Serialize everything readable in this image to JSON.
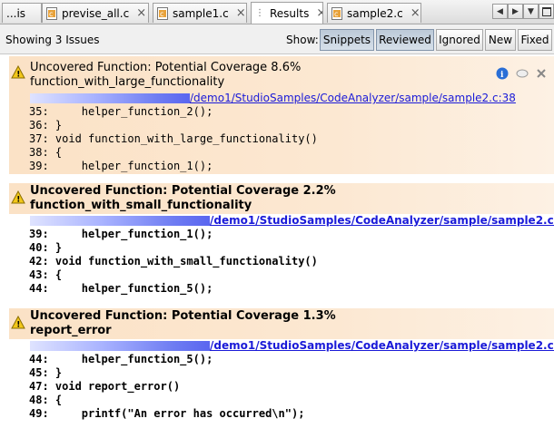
{
  "tabs": [
    {
      "label": "...is",
      "icon": "c-file-icon"
    },
    {
      "label": "previse_all.c",
      "icon": "c-file-icon"
    },
    {
      "label": "sample1.c",
      "icon": "c-file-icon"
    },
    {
      "label": "Results",
      "icon": "results-icon"
    },
    {
      "label": "sample2.c",
      "icon": "c-file-icon"
    }
  ],
  "close_glyph": "×",
  "toolbar": {
    "status": "Showing 3 Issues",
    "show_label": "Show:",
    "filters": [
      {
        "label": "Snippets",
        "pressed": true
      },
      {
        "label": "Reviewed",
        "pressed": true
      },
      {
        "label": "Ignored",
        "pressed": false
      },
      {
        "label": "New",
        "pressed": false
      },
      {
        "label": "Fixed",
        "pressed": false
      }
    ]
  },
  "issues": [
    {
      "title": "Uncovered Function: Potential Coverage 8.6%",
      "function": "function_with_large_functionality",
      "path": "/demo1/StudioSamples/CodeAnalyzer/sample/sample2.c:38",
      "lines": [
        "35:     helper_function_2();",
        "36: }",
        "37: void function_with_large_functionality()",
        "38: {",
        "39:     helper_function_1();"
      ]
    },
    {
      "title": "Uncovered Function: Potential Coverage 2.2%",
      "function": "function_with_small_functionality",
      "path": "/demo1/StudioSamples/CodeAnalyzer/sample/sample2.c:43",
      "lines": [
        "39:     helper_function_1();",
        "40: }",
        "42: void function_with_small_functionality()",
        "43: {",
        "44:     helper_function_5();"
      ]
    },
    {
      "title": "Uncovered Function: Potential Coverage 1.3%",
      "function": "report_error",
      "path": "/demo1/StudioSamples/CodeAnalyzer/sample/sample2.c:48",
      "lines": [
        "44:     helper_function_5();",
        "45: }",
        "47: void report_error()",
        "48: {",
        "49:     printf(\"An error has occurred\\n\");"
      ]
    }
  ],
  "colors": {
    "issue_header": "#fbe2c6",
    "link": "#1a1ad8",
    "info_icon": "#2a6ed6",
    "warning_icon": "#f2c71a"
  }
}
